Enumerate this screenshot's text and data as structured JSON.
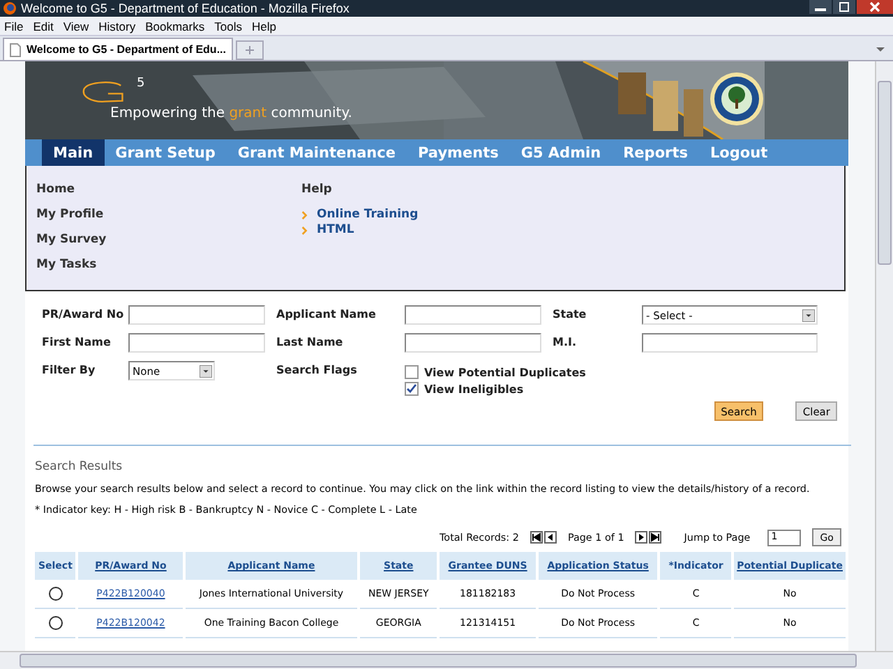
{
  "window": {
    "title": "Welcome to G5 - Department of Education - Mozilla Firefox"
  },
  "menu_bar": [
    "File",
    "Edit",
    "View",
    "History",
    "Bookmarks",
    "Tools",
    "Help"
  ],
  "browser_tabs": [
    {
      "label": "Welcome to G5 - Department of Edu...",
      "selected": true
    }
  ],
  "banner": {
    "logo_superscript": "5",
    "tagline": [
      {
        "text": "Empowering the ",
        "highlight": false
      },
      {
        "text": "grant",
        "highlight": true
      },
      {
        "text": " community.",
        "highlight": false
      }
    ]
  },
  "nav": [
    {
      "label": "Main",
      "selected": true
    },
    {
      "label": "Grant Setup",
      "selected": false
    },
    {
      "label": "Grant Maintenance",
      "selected": false
    },
    {
      "label": "Payments",
      "selected": false
    },
    {
      "label": "G5 Admin",
      "selected": false
    },
    {
      "label": "Reports",
      "selected": false
    },
    {
      "label": "Logout",
      "selected": false
    }
  ],
  "dropdown": {
    "left_items": [
      "Home",
      "My Profile",
      "My Survey",
      "My Tasks"
    ],
    "help_heading": "Help",
    "help_links": [
      "Online Training",
      "HTML"
    ]
  },
  "form": {
    "rows": [
      [
        {
          "label": "PR/Award No",
          "kind": "text"
        },
        {
          "label": "Applicant Name",
          "kind": "text"
        },
        {
          "label": "State",
          "kind": "select",
          "value": "- Select -"
        }
      ],
      [
        {
          "label": "First Name",
          "kind": "text"
        },
        {
          "label": "Last Name",
          "kind": "text"
        },
        {
          "label": "M.I.",
          "kind": "text"
        }
      ],
      [
        {
          "label": "Filter By",
          "kind": "small-select",
          "value": "None"
        },
        {
          "label": "Search Flags",
          "kind": "flags"
        }
      ]
    ],
    "flags": [
      {
        "label": "View Potential Duplicates",
        "checked": false
      },
      {
        "label": "View Ineligibles",
        "checked": true
      }
    ],
    "buttons": [
      {
        "label": "Search",
        "kind": "primary"
      },
      {
        "label": "Clear",
        "kind": "secondary"
      }
    ]
  },
  "results": {
    "title": "Search Results",
    "intro": "Browse your search results below and select a record to continue. You may click on the link within the record listing to view the details/history of a record.",
    "indicator_key": "* Indicator key: H - High risk B - Bankruptcy N - Novice C - Complete L - Late",
    "total": "Total Records: 2",
    "page": "Page 1 of 1",
    "jump_label": "Jump to Page",
    "jump_value": "1",
    "go": "Go",
    "columns": [
      {
        "label": "Select",
        "link": false
      },
      {
        "label": "PR/Award No",
        "link": true
      },
      {
        "label": "Applicant Name",
        "link": true
      },
      {
        "label": "State",
        "link": true
      },
      {
        "label": "Grantee DUNS",
        "link": true
      },
      {
        "label": "Application Status",
        "link": true
      },
      {
        "label": "*Indicator",
        "link": false
      },
      {
        "label": "Potential Duplicate",
        "link": true
      }
    ],
    "rows": [
      {
        "cells": [
          {
            "kind": "radio",
            "selected": false
          },
          {
            "kind": "link",
            "text": "P422B120040"
          },
          {
            "kind": "text",
            "text": "Jones International University"
          },
          {
            "kind": "text",
            "text": "NEW JERSEY"
          },
          {
            "kind": "text",
            "text": "181182183"
          },
          {
            "kind": "text",
            "text": "Do Not Process"
          },
          {
            "kind": "text",
            "text": "C"
          },
          {
            "kind": "text",
            "text": "No"
          }
        ]
      },
      {
        "cells": [
          {
            "kind": "radio",
            "selected": false
          },
          {
            "kind": "link",
            "text": "P422B120042"
          },
          {
            "kind": "text",
            "text": "One Training Bacon College"
          },
          {
            "kind": "text",
            "text": "GEORGIA"
          },
          {
            "kind": "text",
            "text": "121314151"
          },
          {
            "kind": "text",
            "text": "Do Not Process"
          },
          {
            "kind": "text",
            "text": "C"
          },
          {
            "kind": "text",
            "text": "No"
          }
        ]
      }
    ]
  }
}
